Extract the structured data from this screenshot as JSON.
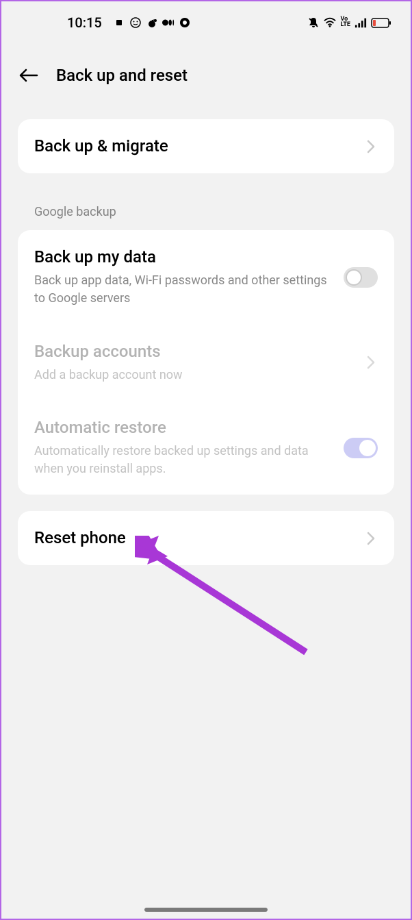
{
  "status": {
    "time": "10:15"
  },
  "header": {
    "title": "Back up and reset"
  },
  "backup_migrate": {
    "title": "Back up & migrate"
  },
  "google_section": {
    "label": "Google backup",
    "backup_data": {
      "title": "Back up my data",
      "subtitle": "Back up app data, Wi-Fi passwords and other settings to Google servers"
    },
    "backup_accounts": {
      "title": "Backup accounts",
      "subtitle": "Add a backup account now"
    },
    "auto_restore": {
      "title": "Automatic restore",
      "subtitle": "Automatically restore backed up settings and data when you reinstall apps."
    }
  },
  "reset": {
    "title": "Reset phone"
  }
}
